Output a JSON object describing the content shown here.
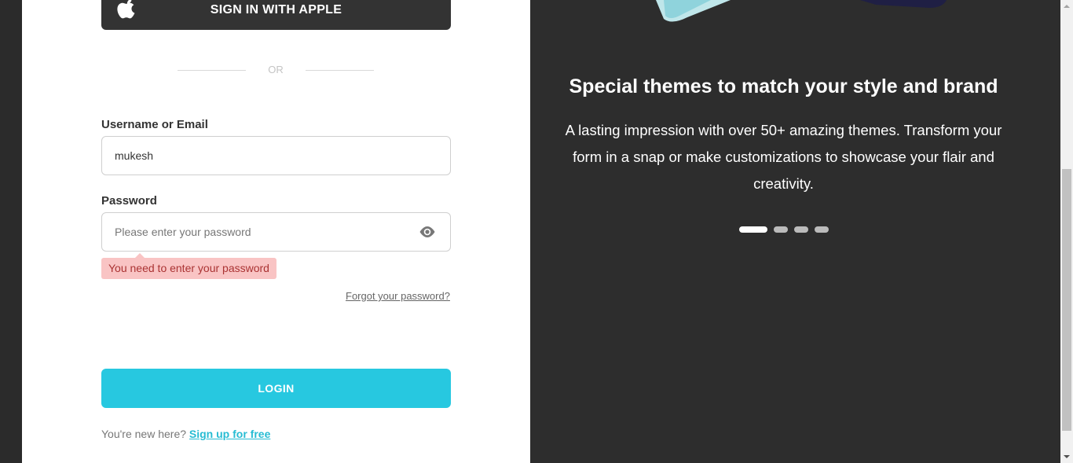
{
  "login_form": {
    "apple_button_label": "SIGN IN WITH APPLE",
    "or_text": "OR",
    "username_label": "Username or Email",
    "username_value": "mukesh",
    "password_label": "Password",
    "password_placeholder": "Please enter your password",
    "password_error": "You need to enter your password",
    "forgot_password_label": "Forgot your password?",
    "login_button_label": "LOGIN",
    "signup_prompt": "You're new here?",
    "signup_link_label": "Sign up for free"
  },
  "promo": {
    "title": "Special themes to match your style and brand",
    "description": "A lasting impression with over 50+ amazing themes. Transform your form in a snap or make customizations to showcase your flair and creativity.",
    "slides": [
      {
        "active": true
      },
      {
        "active": false
      },
      {
        "active": false
      },
      {
        "active": false
      }
    ]
  },
  "icons": {
    "apple": "apple-icon",
    "eye": "eye-icon"
  },
  "colors": {
    "accent": "#27c8e0",
    "link": "#27bcd3",
    "apple_button": "#333333",
    "dark_panel": "#2d2d2d",
    "error_bg": "#f9c4c4",
    "error_text": "#aa3333"
  }
}
